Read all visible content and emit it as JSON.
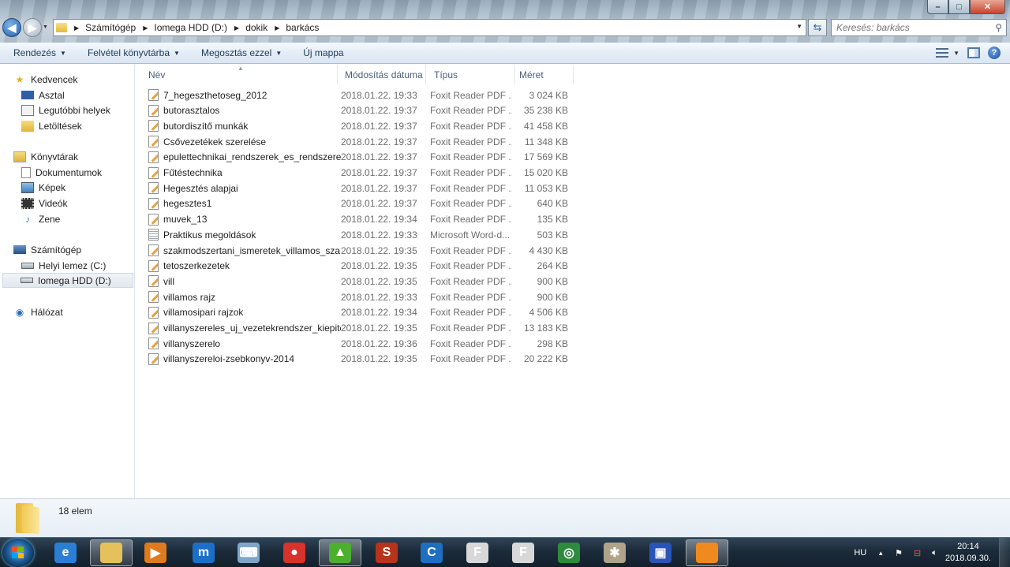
{
  "window": {
    "buttons": {
      "minimize": "–",
      "maximize": "□",
      "close": "✕"
    }
  },
  "address": {
    "segments": [
      "Számítógép",
      "Iomega HDD (D:)",
      "dokik",
      "barkács"
    ]
  },
  "search": {
    "placeholder": "Keresés: barkács"
  },
  "toolbar": {
    "organize": "Rendezés",
    "include_library": "Felvétel könyvtárba",
    "share": "Megosztás ezzel",
    "new_folder": "Új mappa"
  },
  "nav": {
    "favorites": "Kedvencek",
    "desktop": "Asztal",
    "recent": "Legutóbbi helyek",
    "downloads": "Letöltések",
    "libraries": "Könyvtárak",
    "documents": "Dokumentumok",
    "pictures": "Képek",
    "videos": "Videók",
    "music": "Zene",
    "computer": "Számítógép",
    "local_disk": "Helyi lemez (C:)",
    "iomega": "Iomega HDD (D:)",
    "network": "Hálózat"
  },
  "columns": {
    "name": "Név",
    "date": "Módosítás dátuma",
    "type": "Típus",
    "size": "Méret"
  },
  "files": [
    {
      "name": "7_hegeszthetoseg_2012",
      "date": "2018.01.22. 19:33",
      "type": "Foxit Reader PDF ...",
      "size": "3 024 KB",
      "icon": "pdf"
    },
    {
      "name": "butorasztalos",
      "date": "2018.01.22. 19:37",
      "type": "Foxit Reader PDF ...",
      "size": "35 238 KB",
      "icon": "pdf"
    },
    {
      "name": "butordiszítő  munkák",
      "date": "2018.01.22. 19:37",
      "type": "Foxit Reader PDF ...",
      "size": "41 458 KB",
      "icon": "pdf"
    },
    {
      "name": "Csővezetékek szerelése",
      "date": "2018.01.22. 19:37",
      "type": "Foxit Reader PDF ...",
      "size": "11 348 KB",
      "icon": "pdf"
    },
    {
      "name": "epulettechnikai_rendszerek_es_rendszerel...",
      "date": "2018.01.22. 19:37",
      "type": "Foxit Reader PDF ...",
      "size": "17 569 KB",
      "icon": "pdf"
    },
    {
      "name": "Fűtéstechnika",
      "date": "2018.01.22. 19:37",
      "type": "Foxit Reader PDF ...",
      "size": "15 020 KB",
      "icon": "pdf"
    },
    {
      "name": "Hegesztés alapjai",
      "date": "2018.01.22. 19:37",
      "type": "Foxit Reader PDF ...",
      "size": "11 053 KB",
      "icon": "pdf"
    },
    {
      "name": "hegesztes1",
      "date": "2018.01.22. 19:37",
      "type": "Foxit Reader PDF ...",
      "size": "640 KB",
      "icon": "pdf"
    },
    {
      "name": "muvek_13",
      "date": "2018.01.22. 19:34",
      "type": "Foxit Reader PDF ...",
      "size": "135 KB",
      "icon": "pdf"
    },
    {
      "name": "Praktikus megoldások",
      "date": "2018.01.22. 19:33",
      "type": "Microsoft Word-d...",
      "size": "503 KB",
      "icon": "doc"
    },
    {
      "name": "szakmodszertani_ismeretek_villamos_sza...",
      "date": "2018.01.22. 19:35",
      "type": "Foxit Reader PDF ...",
      "size": "4 430 KB",
      "icon": "pdf"
    },
    {
      "name": "tetoszerkezetek",
      "date": "2018.01.22. 19:35",
      "type": "Foxit Reader PDF ...",
      "size": "264 KB",
      "icon": "pdf"
    },
    {
      "name": "vill",
      "date": "2018.01.22. 19:35",
      "type": "Foxit Reader PDF ...",
      "size": "900 KB",
      "icon": "pdf"
    },
    {
      "name": "villamos rajz",
      "date": "2018.01.22. 19:33",
      "type": "Foxit Reader PDF ...",
      "size": "900 KB",
      "icon": "pdf"
    },
    {
      "name": "villamosipari rajzok",
      "date": "2018.01.22. 19:34",
      "type": "Foxit Reader PDF ...",
      "size": "4 506 KB",
      "icon": "pdf"
    },
    {
      "name": "villanyszereles_uj_vezetekrendszer_kiepite...",
      "date": "2018.01.22. 19:35",
      "type": "Foxit Reader PDF ...",
      "size": "13 183 KB",
      "icon": "pdf"
    },
    {
      "name": "villanyszerelo",
      "date": "2018.01.22. 19:36",
      "type": "Foxit Reader PDF ...",
      "size": "298 KB",
      "icon": "pdf"
    },
    {
      "name": "villanyszereloi-zsebkonyv-2014",
      "date": "2018.01.22. 19:35",
      "type": "Foxit Reader PDF ...",
      "size": "20 222 KB",
      "icon": "pdf"
    }
  ],
  "status": {
    "count": "18 elem"
  },
  "taskbar": {
    "apps": [
      {
        "name": "internet-explorer-icon",
        "glyph": "e",
        "color": "#2a7fd4"
      },
      {
        "name": "explorer-icon",
        "glyph": "",
        "color": "#e4c15a",
        "active": true
      },
      {
        "name": "media-player-icon",
        "glyph": "▶",
        "color": "#e07a1f"
      },
      {
        "name": "maxthon-icon",
        "glyph": "m",
        "color": "#1b6fc9"
      },
      {
        "name": "keyboard-app-icon",
        "glyph": "⌨",
        "color": "#7fa6c9"
      },
      {
        "name": "video-record-icon",
        "glyph": "●",
        "color": "#d7322b"
      },
      {
        "name": "aimp-icon",
        "glyph": "▲",
        "color": "#4caf2e",
        "active": true
      },
      {
        "name": "game-s-icon",
        "glyph": "S",
        "color": "#b8331c"
      },
      {
        "name": "ccleaner-icon",
        "glyph": "C",
        "color": "#1e6fbf"
      },
      {
        "name": "foxit-doc-icon",
        "glyph": "F",
        "color": "#d8d8d8"
      },
      {
        "name": "foxit-doc2-icon",
        "glyph": "F",
        "color": "#d8d8d8"
      },
      {
        "name": "radar-icon",
        "glyph": "◎",
        "color": "#2e8b3d"
      },
      {
        "name": "tools-icon",
        "glyph": "✱",
        "color": "#b0a38a"
      },
      {
        "name": "floppy-save-icon",
        "glyph": "▣",
        "color": "#2a54b5"
      },
      {
        "name": "foxit-reader-icon",
        "glyph": "",
        "color": "#f08a1e",
        "active": true
      }
    ],
    "lang": "HU",
    "time": "20:14",
    "date": "2018.09.30."
  }
}
